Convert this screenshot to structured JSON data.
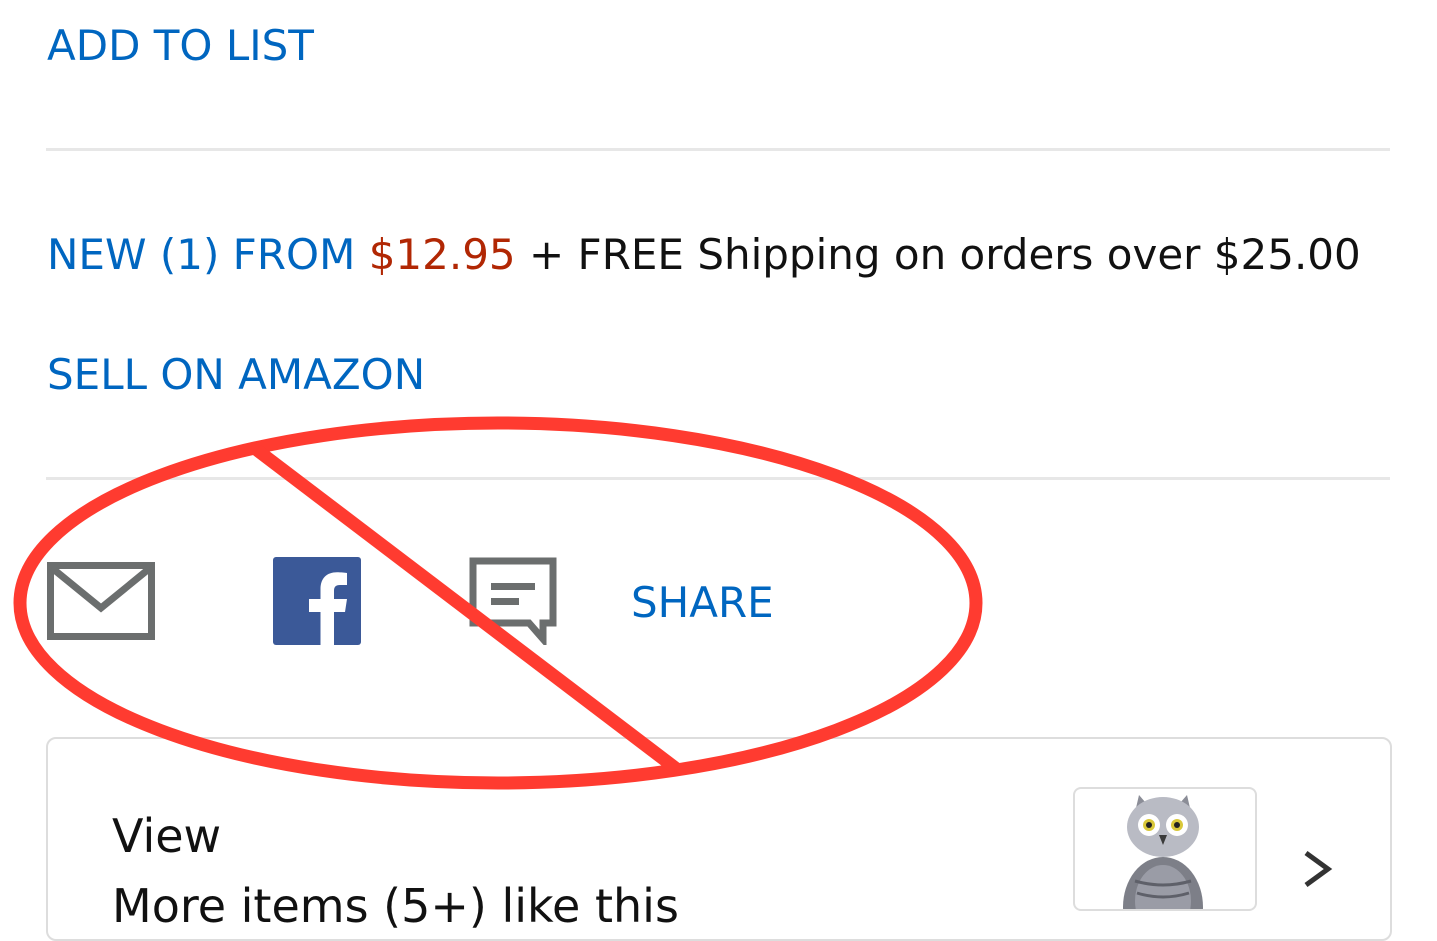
{
  "actions": {
    "add_to_list": "ADD TO LIST",
    "sell_on_amazon": "SELL ON AMAZON"
  },
  "offer": {
    "new_from_label": "NEW (1) FROM",
    "price": "$12.95",
    "shipping": "+ FREE Shipping on orders over $25.00"
  },
  "share": {
    "icons": [
      "email-icon",
      "facebook-icon",
      "message-icon"
    ],
    "label": "SHARE"
  },
  "recommendation": {
    "line1": "View",
    "line2": "More items (5+) like this",
    "thumbnail": "owl-figurine-thumbnail"
  },
  "colors": {
    "link": "#0066c0",
    "price": "#b12704",
    "text": "#111111",
    "divider": "#e7e7e7",
    "icon_gray": "#6b6e6e",
    "facebook": "#3b5998",
    "annotation": "#ff3b30"
  }
}
